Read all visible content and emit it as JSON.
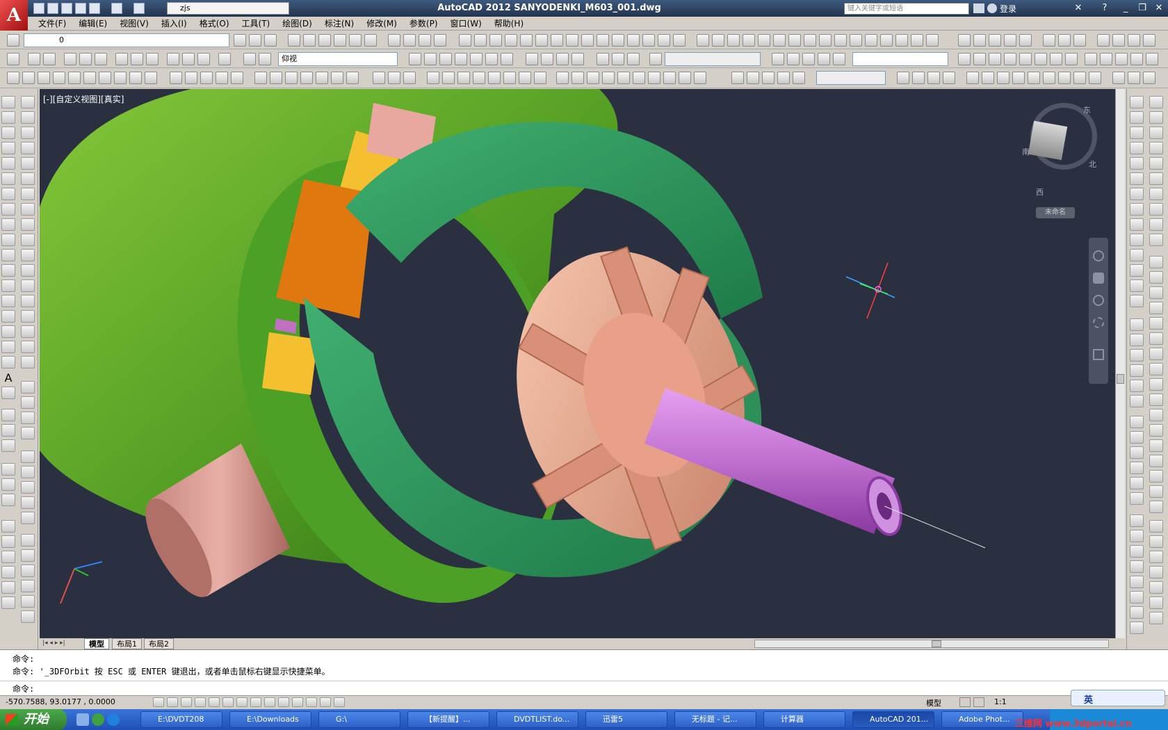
{
  "app": {
    "logo": "A",
    "title": "AutoCAD 2012    SANYODENKI_M603_001.dwg",
    "workspace": "zjs",
    "search_placeholder": "键入关键字或短语",
    "login": "登录"
  },
  "menu": [
    "文件(F)",
    "编辑(E)",
    "视图(V)",
    "插入(I)",
    "格式(O)",
    "工具(T)",
    "绘图(D)",
    "标注(N)",
    "修改(M)",
    "参数(P)",
    "窗口(W)",
    "帮助(H)"
  ],
  "toolbars": {
    "layer_value": "0",
    "view_value": "仰视"
  },
  "viewport": {
    "label": "[-][自定义视图][真实]",
    "viewcube_label": "未命名",
    "compass": {
      "north": "北",
      "south": "南",
      "east": "东",
      "west": "西"
    }
  },
  "tabs": [
    "模型",
    "布局1",
    "布局2"
  ],
  "command": {
    "line1": "命令:",
    "line2": "命令: '_3DFOrbit 按 ESC 或 ENTER 键退出，或者单击鼠标右键显示快捷菜单。",
    "prompt": "命令:"
  },
  "status": {
    "coords": "-570.7588, 93.0177 , 0.0000",
    "model": "模型",
    "scale": "1:1"
  },
  "taskbar": {
    "start": "开始",
    "items": [
      "E:\\DVDT208",
      "E:\\Downloads",
      "G:\\",
      "【新提醒】...",
      "DVDTLIST.do...",
      "迅雷5",
      "无标题 - 记...",
      "计算器",
      "AutoCAD 201...",
      "Adobe Phot..."
    ],
    "tray_ime": "英",
    "watermark": "三维网 www.3dportal.cn"
  }
}
